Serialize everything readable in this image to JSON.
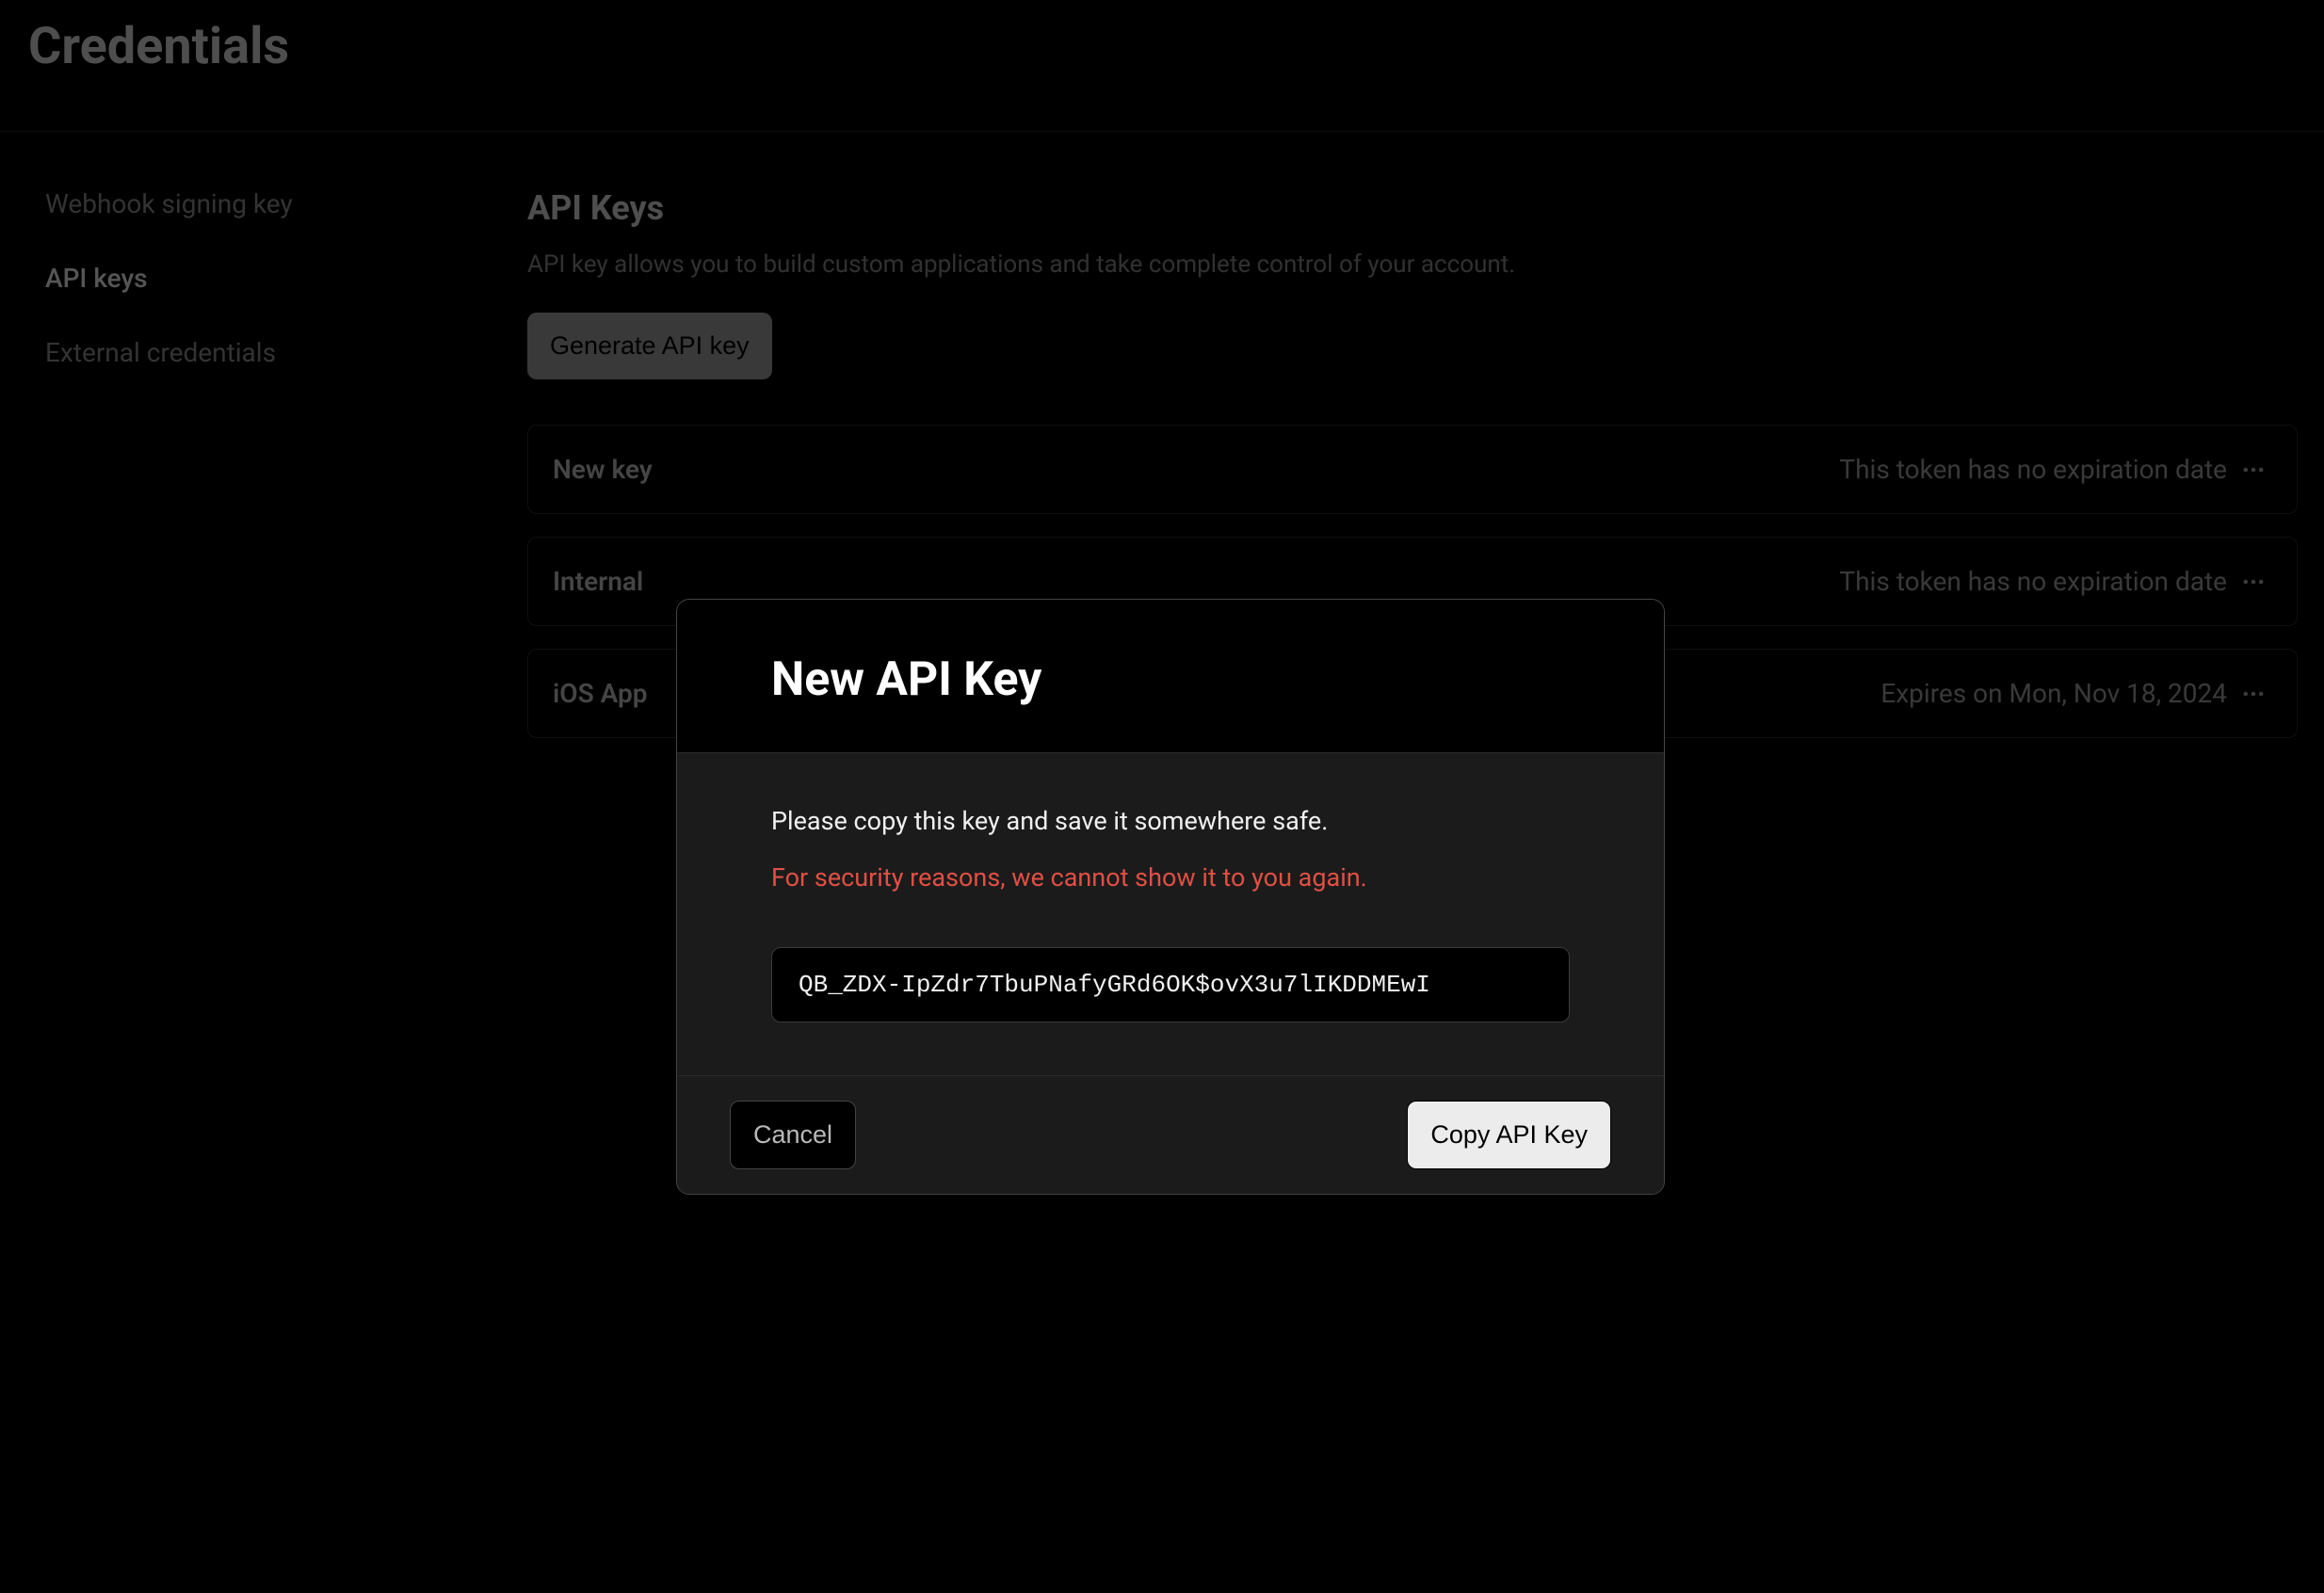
{
  "page_title": "Credentials",
  "sidebar": {
    "items": [
      {
        "label": "Webhook signing key"
      },
      {
        "label": "API keys"
      },
      {
        "label": "External credentials"
      }
    ],
    "active_index": 1
  },
  "section": {
    "title": "API Keys",
    "description": "API key allows you to build custom applications and take complete control of your account.",
    "generate_button": "Generate API key"
  },
  "keys": [
    {
      "name": "New key",
      "meta": "This token has no expiration date"
    },
    {
      "name": "Internal",
      "meta": "This token has no expiration date"
    },
    {
      "name": "iOS App",
      "meta": "Expires on Mon, Nov 18, 2024"
    }
  ],
  "modal": {
    "title": "New API Key",
    "line1": "Please copy this key and save it somewhere safe.",
    "line2": "For security reasons, we cannot show it to you again.",
    "key_value": "QB_ZDX-IpZdr7TbuPNafyGRd6OK$ovX3u7lIKDDMEwI",
    "cancel": "Cancel",
    "copy": "Copy API Key"
  }
}
